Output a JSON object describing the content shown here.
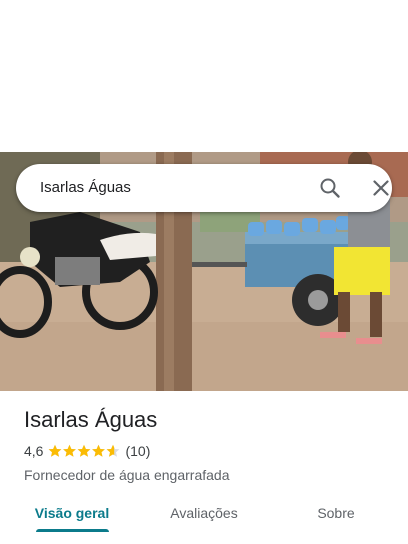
{
  "search": {
    "query": "Isarlas Águas",
    "search_icon": "search-icon",
    "close_icon": "close-icon"
  },
  "place": {
    "name": "Isarlas Águas",
    "rating": "4,6",
    "rating_fraction": 0.92,
    "reviews_count": "(10)",
    "category": "Fornecedor de água engarrafada",
    "photo_subject": "place-photo"
  },
  "tabs": [
    {
      "label": "Visão geral",
      "active": true
    },
    {
      "label": "Avaliações",
      "active": false
    },
    {
      "label": "Sobre",
      "active": false
    }
  ],
  "colors": {
    "accent": "#0b7b8b",
    "star": "#fbbc04"
  }
}
